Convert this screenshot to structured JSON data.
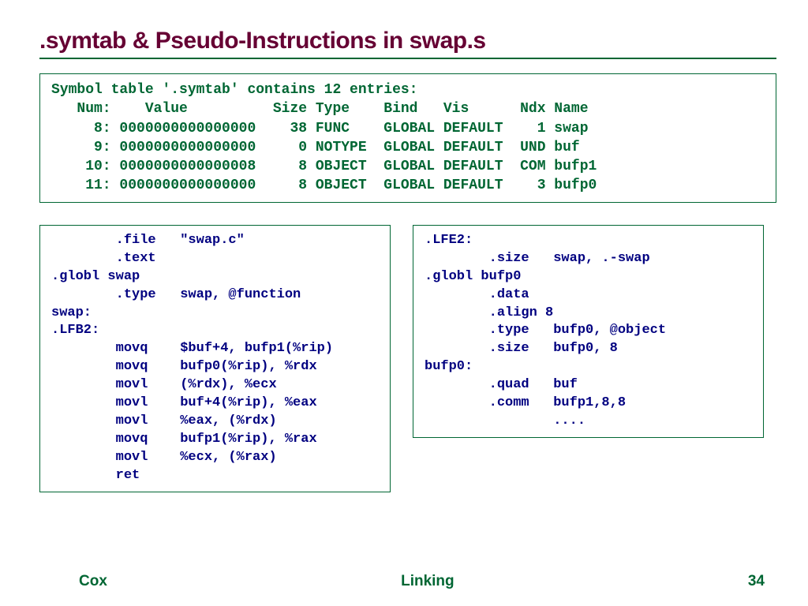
{
  "title": ".symtab & Pseudo-Instructions in swap.s",
  "symtab": "Symbol table '.symtab' contains 12 entries:\n   Num:    Value          Size Type    Bind   Vis      Ndx Name\n     8: 0000000000000000    38 FUNC    GLOBAL DEFAULT    1 swap\n     9: 0000000000000000     0 NOTYPE  GLOBAL DEFAULT  UND buf\n    10: 0000000000000008     8 OBJECT  GLOBAL DEFAULT  COM bufp1\n    11: 0000000000000000     8 OBJECT  GLOBAL DEFAULT    3 bufp0",
  "asm_left": "        .file   \"swap.c\"\n        .text\n.globl swap\n        .type   swap, @function\nswap:\n.LFB2:\n        movq    $buf+4, bufp1(%rip)\n        movq    bufp0(%rip), %rdx\n        movl    (%rdx), %ecx\n        movl    buf+4(%rip), %eax\n        movl    %eax, (%rdx)\n        movq    bufp1(%rip), %rax\n        movl    %ecx, (%rax)\n        ret",
  "asm_right": ".LFE2:\n        .size   swap, .-swap\n.globl bufp0\n        .data\n        .align 8\n        .type   bufp0, @object\n        .size   bufp0, 8\nbufp0:\n        .quad   buf\n        .comm   bufp1,8,8\n                ....",
  "footer": {
    "left": "Cox",
    "center": "Linking",
    "right": "34"
  }
}
